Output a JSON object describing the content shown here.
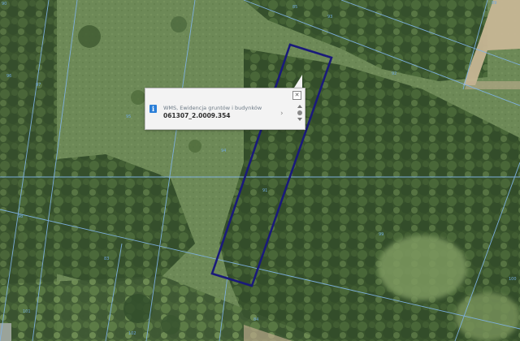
{
  "map": {
    "parcel_labels": [
      "97",
      "96",
      "95",
      "94",
      "91",
      "92",
      "93",
      "98",
      "99",
      "100",
      "101",
      "102",
      "89",
      "90",
      "83",
      "84",
      "85"
    ],
    "colors": {
      "parcel_outline": "#1a1a7a",
      "cadastral_lines": "#7fb3e6",
      "vegetation_dark": "#2f4a2a",
      "vegetation_light": "#6e8a56",
      "road": "#c9b79a"
    }
  },
  "popup": {
    "close_icon": "✕",
    "info_icon": "i",
    "layer_name": "WMS, Ewidencja gruntów i budynków",
    "parcel_id": "061307_2.0009.354",
    "next_icon": "›"
  }
}
